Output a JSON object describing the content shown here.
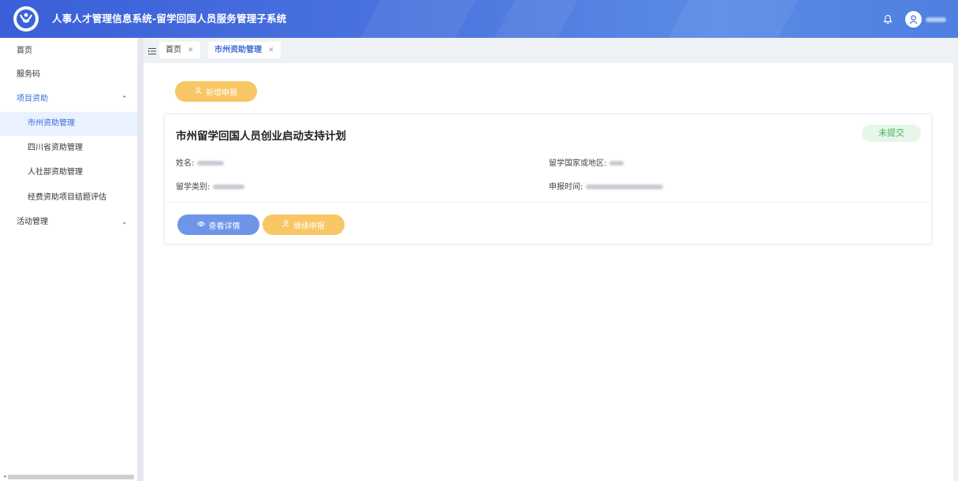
{
  "header": {
    "app_title": "人事人才管理信息系统-留学回国人员服务管理子系统",
    "icons": [
      "logo-icon",
      "bell-icon",
      "user-avatar-icon"
    ],
    "accent_color": "#4a72de"
  },
  "sidebar": {
    "items": [
      {
        "label": "首页"
      },
      {
        "label": "服务码"
      },
      {
        "label": "项目资助",
        "expanded": true
      },
      {
        "label": "市州资助管理",
        "active": true
      },
      {
        "label": "四川省资助管理"
      },
      {
        "label": "人社部资助管理"
      },
      {
        "label": "经费资助项目结题评估"
      },
      {
        "label": "活动管理",
        "expanded": false
      }
    ]
  },
  "tabs": [
    {
      "label": "首页",
      "active": false
    },
    {
      "label": "市州资助管理",
      "active": true
    }
  ],
  "toolbar": {
    "new_label": "新增申报"
  },
  "card": {
    "title": "市州留学回国人员创业启动支持计划",
    "status": "未提交",
    "status_color": "#41b55e",
    "name_label": "姓名:",
    "country_label": "留学国家或地区:",
    "type_label": "留学类别:",
    "time_label": "申报时间:",
    "view_label": "查看详情",
    "continue_label": "继续申报"
  }
}
